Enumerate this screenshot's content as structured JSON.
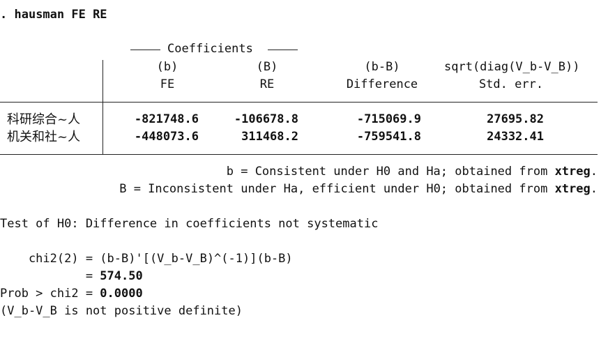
{
  "command": {
    "prev_dot": ".",
    "prompt": ". ",
    "text": "hausman FE RE"
  },
  "table": {
    "group_label": "Coefficients",
    "columns": [
      {
        "top": "(b)",
        "bottom": "FE"
      },
      {
        "top": "(B)",
        "bottom": "RE"
      },
      {
        "top": "(b-B)",
        "bottom": "Difference"
      },
      {
        "top": "sqrt(diag(V_b-V_B))",
        "bottom": "Std. err."
      }
    ],
    "rows": [
      {
        "label": "科研综合~人",
        "b": "-821748.6",
        "B": "-106678.8",
        "diff": "-715069.9",
        "se": "27695.82"
      },
      {
        "label": "机关和社~人",
        "b": "-448073.6",
        "B": "311468.2",
        "diff": "-759541.8",
        "se": "24332.41"
      }
    ]
  },
  "notes": {
    "b_prefix": "b = Consistent under H0 and Ha; obtained from ",
    "b_cmd": "xtreg",
    "b_suffix": ".",
    "B_prefix": "B = Inconsistent under Ha, efficient under H0; obtained from ",
    "B_cmd": "xtreg",
    "B_suffix": "."
  },
  "test": {
    "h0": "Test of H0: Difference in coefficients not systematic",
    "chi2_lhs": "    chi2(2) = ",
    "chi2_formula": "(b-B)'[(V_b-V_B)^(-1)](b-B)",
    "eq_prefix": "            = ",
    "chi2_value": "574.50",
    "prob_prefix": "Prob > chi2 = ",
    "prob_value": "0.0000",
    "warning": "(V_b-V_B is not positive definite)"
  }
}
